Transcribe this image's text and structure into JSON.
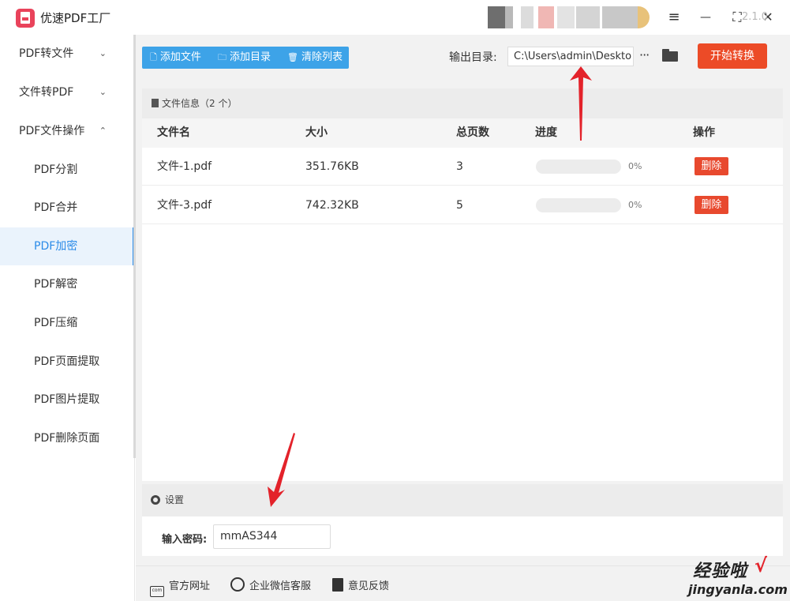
{
  "app": {
    "title": "优速PDF工厂"
  },
  "window_controls": {
    "menu_icon": "≡",
    "minimize_icon": "—",
    "maximize_icon": "⛶",
    "close_icon": "✕"
  },
  "sidebar": {
    "items": [
      {
        "label": "PDF转文件",
        "chevron": "⌄"
      },
      {
        "label": "文件转PDF",
        "chevron": "⌄"
      },
      {
        "label": "PDF文件操作",
        "chevron": "⌃"
      },
      {
        "label": "PDF分割"
      },
      {
        "label": "PDF合并"
      },
      {
        "label": "PDF加密",
        "active": true
      },
      {
        "label": "PDF解密"
      },
      {
        "label": "PDF压缩"
      },
      {
        "label": "PDF页面提取"
      },
      {
        "label": "PDF图片提取"
      },
      {
        "label": "PDF删除页面"
      }
    ]
  },
  "toolbar": {
    "add_file": "添加文件",
    "add_dir": "添加目录",
    "clear_list": "清除列表",
    "output_label": "输出目录:",
    "output_path": "C:\\Users\\admin\\Deskto",
    "more": "···",
    "start": "开始转换"
  },
  "file_panel": {
    "header": "文件信息（2 个）",
    "columns": [
      "文件名",
      "大小",
      "总页数",
      "进度",
      "操作"
    ],
    "rows": [
      {
        "name": "文件-1.pdf",
        "size": "351.76KB",
        "pages": "3",
        "progress": 0,
        "progress_text": "0%",
        "action": "删除"
      },
      {
        "name": "文件-3.pdf",
        "size": "742.32KB",
        "pages": "5",
        "progress": 0,
        "progress_text": "0%",
        "action": "删除"
      }
    ]
  },
  "settings": {
    "header": "设置",
    "password_label": "输入密码:",
    "password_value": "mmAS344"
  },
  "footer": {
    "website": "官方网址",
    "wechat": "企业微信客服",
    "feedback": "意见反馈",
    "version": "2.1.0"
  },
  "watermark": {
    "cn": "经验啦",
    "check": "√",
    "en": "jingyanla.com"
  },
  "colors": {
    "accent": "#3da3e8",
    "danger": "#e8492e",
    "start": "#ec4b27",
    "arrow": "#e3222a"
  }
}
